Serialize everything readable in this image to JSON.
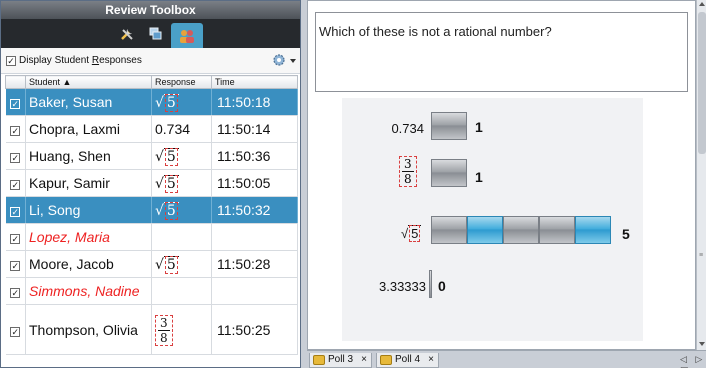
{
  "toolbox": {
    "title": "Review Toolbox",
    "tabs": [
      {
        "icon": "tools-icon"
      },
      {
        "icon": "screens-icon"
      },
      {
        "icon": "class-results-icon",
        "active": true
      }
    ],
    "display_check": "✓",
    "display_label_pre": "Display Student ",
    "display_label_u": "R",
    "display_label_post": "esponses",
    "settings_icon": "gear-icon"
  },
  "table": {
    "headers": {
      "student": "Student ▲",
      "response": "Response",
      "time": "Time"
    },
    "rows": [
      {
        "name": "Baker, Susan",
        "response": "sqrt5",
        "time": "11:50:18",
        "selected": true
      },
      {
        "name": "Chopra, Laxmi",
        "response": "0.734",
        "time": "11:50:14"
      },
      {
        "name": "Huang, Shen",
        "response": "sqrt5",
        "time": "11:50:36"
      },
      {
        "name": "Kapur, Samir",
        "response": "sqrt5",
        "time": "11:50:05"
      },
      {
        "name": "Li, Song",
        "response": "sqrt5",
        "time": "11:50:32",
        "selected": true
      },
      {
        "name": "Lopez, Maria",
        "response": "",
        "time": "",
        "no_response": true
      },
      {
        "name": "Moore, Jacob",
        "response": "sqrt5",
        "time": "11:50:28"
      },
      {
        "name": "Simmons, Nadine",
        "response": "",
        "time": "",
        "no_response": true
      },
      {
        "name": "Thompson, Olivia",
        "response": "frac3_8",
        "time": "11:50:25"
      }
    ],
    "sqrt_radicand": "5",
    "check": "✓"
  },
  "question": {
    "text": "Which of these is not a rational number?"
  },
  "chart_data": {
    "type": "bar",
    "categories": [
      "0.734",
      "3/8",
      "√5",
      "3.33333"
    ],
    "values": [
      1,
      1,
      5,
      0
    ],
    "highlighted_per_category": [
      0,
      0,
      2,
      0
    ]
  },
  "chart_labels": {
    "cat0": "0.734",
    "cat1_num": "3",
    "cat1_den": "8",
    "cat2": "5",
    "cat3": "3.33333",
    "count0": "1",
    "count1": "1",
    "count2": "5",
    "count3": "0"
  },
  "polls": [
    {
      "label": "Poll 3",
      "close": "×"
    },
    {
      "label": "Poll 4",
      "close": "×"
    }
  ],
  "poll_nav": "◁ ▷ ▤"
}
